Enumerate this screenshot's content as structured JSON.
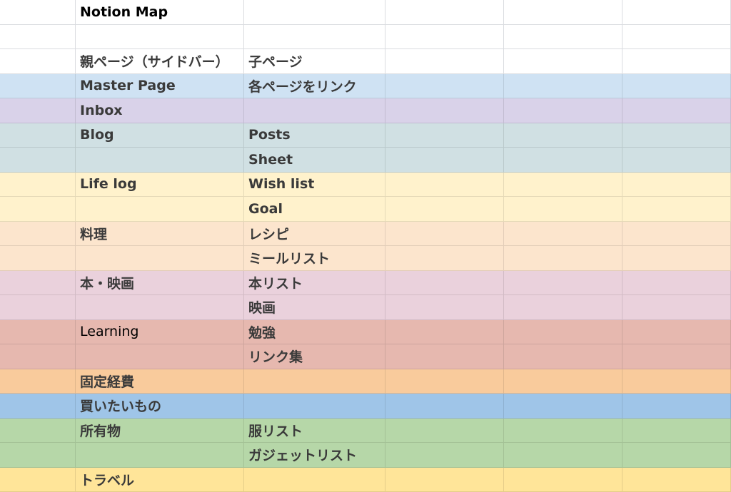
{
  "title": "Notion Map",
  "header": {
    "parent": "親ページ（サイドバー）",
    "child": "子ページ"
  },
  "rows": [
    {
      "parent": "Master Page",
      "child": "各ページをリンク",
      "color": "#cfe2f3"
    },
    {
      "parent": "Inbox",
      "child": "",
      "color": "#d9d2e9"
    },
    {
      "parent": "Blog",
      "child": "Posts",
      "color": "#d0e0e3"
    },
    {
      "parent": "",
      "child": "Sheet",
      "color": "#d0e0e3"
    },
    {
      "parent": "Life log",
      "child": "Wish list",
      "color": "#fff2cc"
    },
    {
      "parent": "",
      "child": "Goal",
      "color": "#fff2cc"
    },
    {
      "parent": "料理",
      "child": "レシピ",
      "color": "#fce5cd"
    },
    {
      "parent": "",
      "child": "ミールリスト",
      "color": "#fce5cd"
    },
    {
      "parent": "本・映画",
      "child": "本リスト",
      "color": "#ead1dc"
    },
    {
      "parent": "",
      "child": "映画",
      "color": "#ead1dc"
    },
    {
      "parent": "Learning",
      "child": "勉強",
      "color": "#e6b8af",
      "parent_plain": true
    },
    {
      "parent": "",
      "child": "リンク集",
      "color": "#e6b8af"
    },
    {
      "parent": "固定経費",
      "child": "",
      "color": "#f9cb9c"
    },
    {
      "parent": "買いたいもの",
      "child": "",
      "color": "#9fc5e8"
    },
    {
      "parent": "所有物",
      "child": "服リスト",
      "color": "#b6d7a8"
    },
    {
      "parent": "",
      "child": "ガジェットリスト",
      "color": "#b6d7a8"
    },
    {
      "parent": "トラベル",
      "child": "",
      "color": "#ffe599"
    }
  ]
}
